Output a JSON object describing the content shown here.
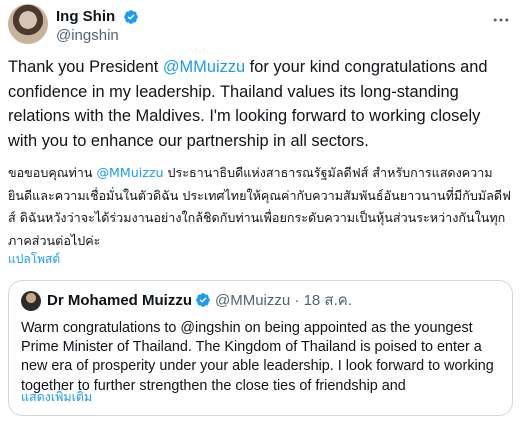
{
  "author": {
    "display_name": "Ing Shin",
    "handle": "@ingshin"
  },
  "tweet": {
    "en_before_mention": "Thank you President ",
    "en_mention": "@MMuizzu",
    "en_after_mention": " for your kind congratulations and confidence in my leadership. Thailand values its long-standing relations with the Maldives. I'm looking forward to working closely with you to enhance our partnership in all sectors.",
    "th_before_mention": "ขอขอบคุณท่าน ",
    "th_mention": "@MMuizzu",
    "th_after_mention": " ประธานาธิบดีแห่งสาธารณรัฐมัลดีฟส์ สำหรับการแสดงความยินดีและความเชื่อมั่นในตัวดิฉัน ประเทศไทยให้คุณค่ากับความสัมพันธ์อันยาวนานที่มีกับมัลดีฟส์ ดิฉันหวังว่าจะได้ร่วมงานอย่างใกล้ชิดกับท่านเพื่อยกระดับความเป็นหุ้นส่วนระหว่างกันในทุกภาคส่วนต่อไปค่ะ",
    "translate_label": "แปลโพสต์"
  },
  "quoted": {
    "display_name": "Dr Mohamed Muizzu",
    "handle": "@MMuizzu",
    "separator": "·",
    "date": "18 ส.ค.",
    "text": "Warm congratulations to @ingshin on being appointed as the youngest Prime Minister of Thailand. The Kingdom of Thailand is poised to enter a new era of prosperity under your able leadership. I look forward to working together to further strengthen the close ties of friendship and",
    "show_more_label": "แสดงเพิ่มเติม"
  },
  "icons": {
    "verified": "verified-badge-icon",
    "more": "more-options-icon"
  },
  "colors": {
    "accent": "#1d9bf0",
    "text": "#0f1419",
    "muted": "#536471",
    "border": "#cfd9de"
  }
}
